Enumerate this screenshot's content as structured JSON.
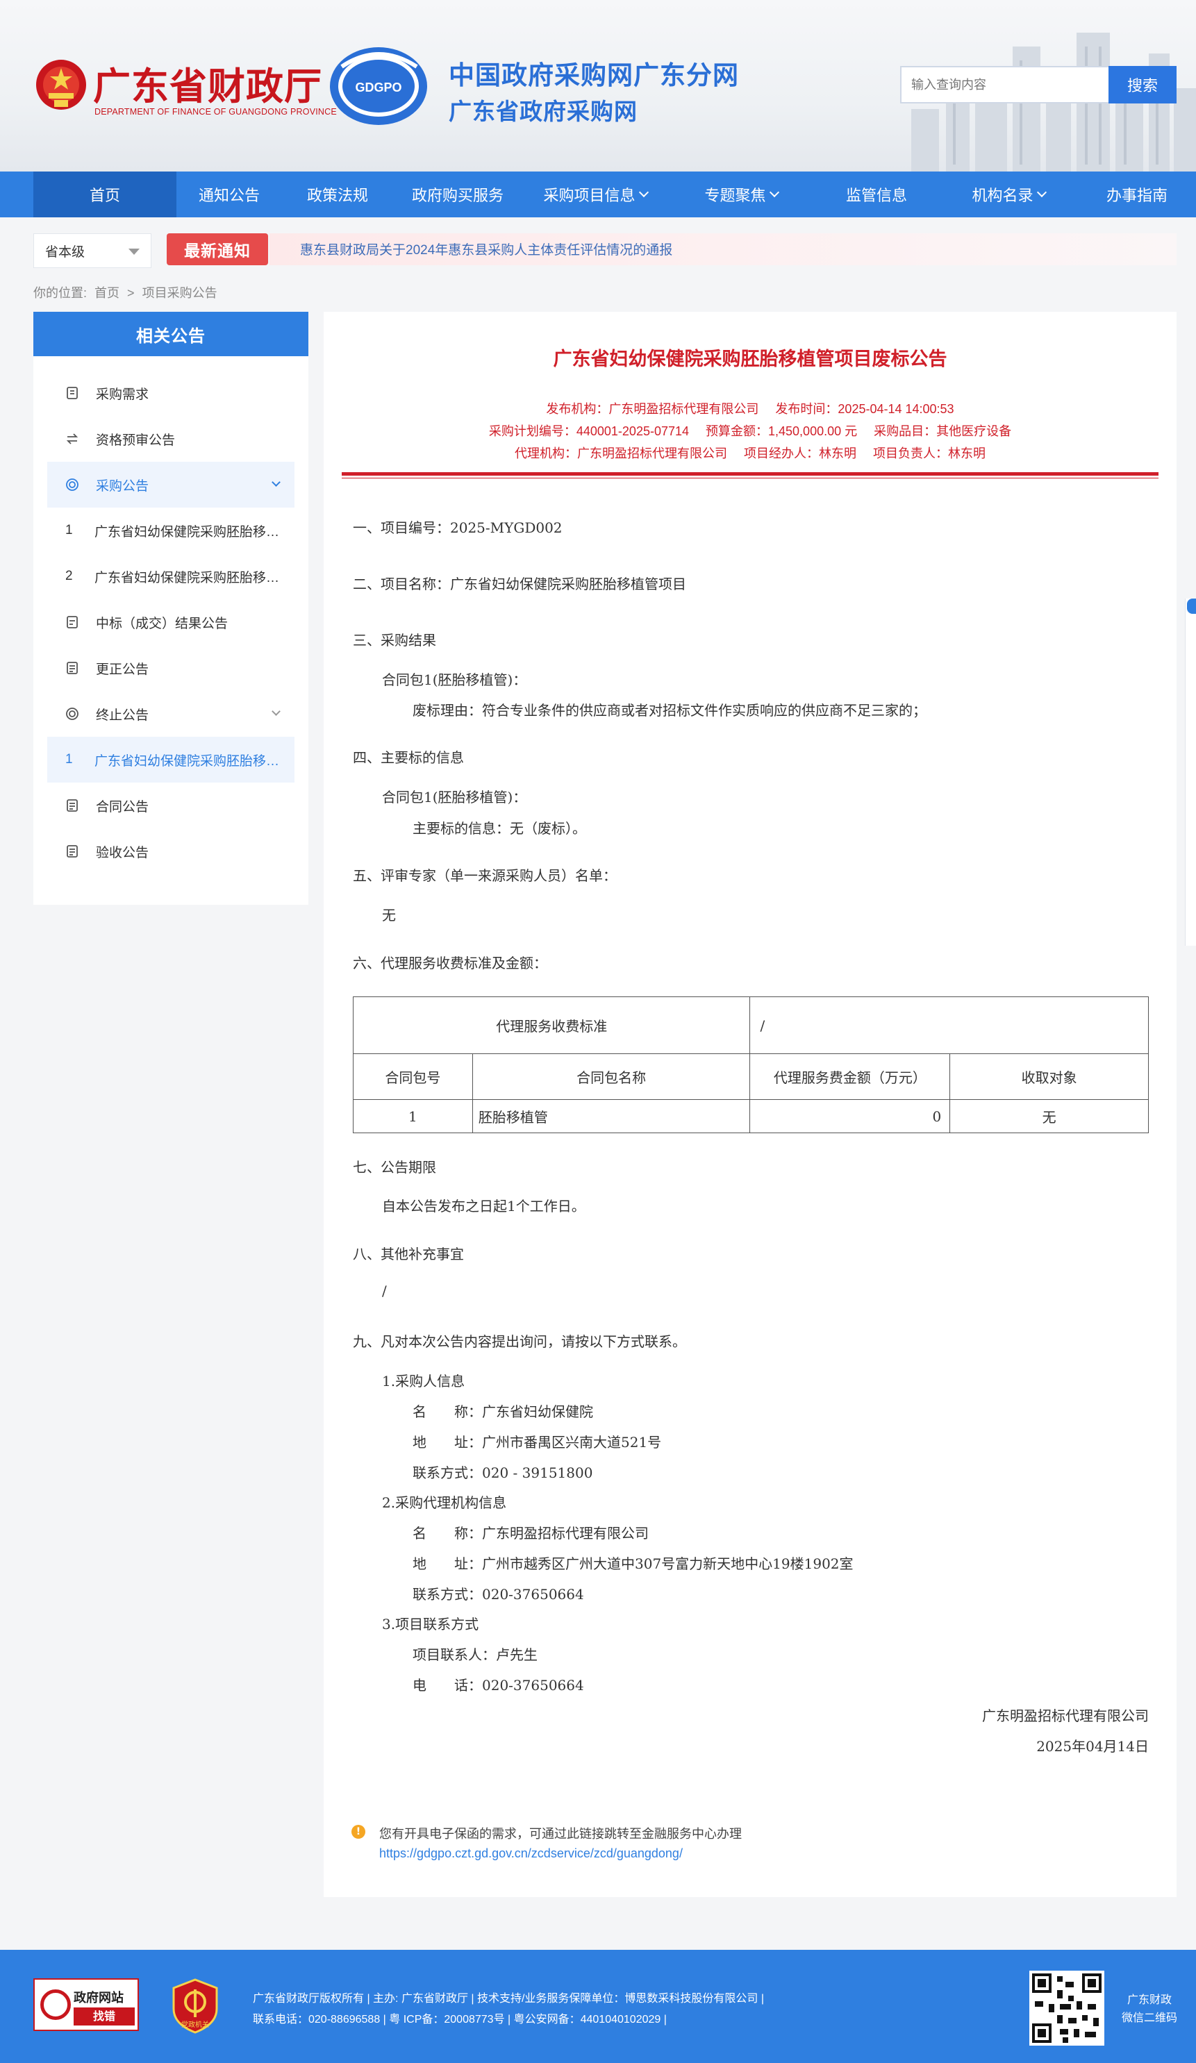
{
  "header": {
    "dept_title": "广东省财政厅",
    "dept_subtitle": "DEPARTMENT OF FINANCE OF GUANGDONG PROVINCE",
    "logo_text": "GDGPO",
    "site_title": "中国政府采购网广东分网",
    "site_subtitle": "广东省政府采购网",
    "search": {
      "placeholder": "输入查询内容",
      "button": "搜索"
    }
  },
  "nav": [
    {
      "label": "首页",
      "active": true,
      "has_menu": false
    },
    {
      "label": "通知公告",
      "has_menu": false
    },
    {
      "label": "政策法规",
      "has_menu": false
    },
    {
      "label": "政府购买服务",
      "has_menu": false
    },
    {
      "label": "采购项目信息",
      "has_menu": true
    },
    {
      "label": "专题聚焦",
      "has_menu": true
    },
    {
      "label": "监管信息",
      "has_menu": false
    },
    {
      "label": "机构名录",
      "has_menu": true
    },
    {
      "label": "办事指南",
      "has_menu": false
    }
  ],
  "notice": {
    "level": "省本级",
    "badge": "最新通知",
    "text": "惠东县财政局关于2024年惠东县采购人主体责任评估情况的通报"
  },
  "breadcrumb": {
    "prefix": "你的位置:",
    "home": "首页",
    "sep": ">",
    "current": "项目采购公告"
  },
  "sidebar": {
    "title": "相关公告",
    "items": [
      {
        "type": "cat",
        "icon": "list-icon",
        "label": "采购需求"
      },
      {
        "type": "cat",
        "icon": "swap-icon",
        "label": "资格预审公告"
      },
      {
        "type": "cat",
        "icon": "target-icon",
        "label": "采购公告",
        "selected": true,
        "expand": true
      },
      {
        "type": "sub",
        "num": "1",
        "label": "广东省妇幼保健院采购胚胎移植管项目"
      },
      {
        "type": "sub",
        "num": "2",
        "label": "广东省妇幼保健院采购胚胎移植管项目"
      },
      {
        "type": "cat",
        "icon": "award-icon",
        "label": "中标（成交）结果公告"
      },
      {
        "type": "cat",
        "icon": "doc-icon",
        "label": "更正公告"
      },
      {
        "type": "cat",
        "icon": "target-icon",
        "label": "终止公告",
        "expand": true
      },
      {
        "type": "sub",
        "num": "1",
        "label": "广东省妇幼保健院采购胚胎移植管项目",
        "selected": true
      },
      {
        "type": "cat",
        "icon": "doc-icon",
        "label": "合同公告"
      },
      {
        "type": "cat",
        "icon": "doc-icon",
        "label": "验收公告"
      }
    ]
  },
  "article": {
    "title": "广东省妇幼保健院采购胚胎移植管项目废标公告",
    "meta1": [
      "发布机构：广东明盈招标代理有限公司",
      "发布时间：2025-04-14 14:00:53"
    ],
    "meta2": [
      "采购计划编号：440001-2025-07714",
      "预算金额：1,450,000.00 元",
      "采购品目：其他医疗设备"
    ],
    "meta3": [
      "代理机构：广东明盈招标代理有限公司",
      "项目经办人：林东明",
      "项目负责人：林东明"
    ],
    "s1": "一、项目编号：2025-MYGD002",
    "s2": "二、项目名称：广东省妇幼保健院采购胚胎移植管项目",
    "s3": "三、采购结果",
    "s3_pkg": "合同包1(胚胎移植管)：",
    "s3_reason": "废标理由：符合专业条件的供应商或者对招标文件作实质响应的供应商不足三家的；",
    "s4": "四、主要标的信息",
    "s4_pkg": "合同包1(胚胎移植管)：",
    "s4_info": "主要标的信息：无（废标）。",
    "s5": "五、评审专家（单一来源采购人员）名单：",
    "s5_val": "无",
    "s6": "六、代理服务收费标准及金额：",
    "fee_table": {
      "std_label": "代理服务收费标准",
      "std_value": "/",
      "headers": [
        "合同包号",
        "合同包名称",
        "代理服务费金额（万元）",
        "收取对象"
      ],
      "rows": [
        [
          "1",
          "胚胎移植管",
          "0",
          "无"
        ]
      ]
    },
    "s7": "七、公告期限",
    "s7_val": "自本公告发布之日起1个工作日。",
    "s8": "八、其他补充事宜",
    "s8_val": "/",
    "s9": "九、凡对本次公告内容提出询问，请按以下方式联系。",
    "c1_title": "1.采购人信息",
    "c1_name": "名　　称：广东省妇幼保健院",
    "c1_addr": "地　　址：广州市番禺区兴南大道521号",
    "c1_tel": "联系方式：020 - 39151800",
    "c2_title": "2.采购代理机构信息",
    "c2_name": "名　　称：广东明盈招标代理有限公司",
    "c2_addr": "地　　址：广州市越秀区广州大道中307号富力新天地中心19楼1902室",
    "c2_tel": "联系方式：020-37650664",
    "c3_title": "3.项目联系方式",
    "c3_person": "项目联系人：卢先生",
    "c3_tel": "电　　话：020-37650664",
    "sign_org": "广东明盈招标代理有限公司",
    "sign_date": "2025年04月14日",
    "tip_text": "您有开具电子保函的需求，可通过此链接跳转至金融服务中心办理",
    "tip_link": "https://gdgpo.czt.gd.gov.cn/zcdservice/zcd/guangdong/"
  },
  "footer": {
    "gov_badge_l1": "政府网站",
    "gov_badge_l2": "找错",
    "party_badge": "党政机关",
    "line1": "广东省财政厅版权所有 | 主办: 广东省财政厅 | 技术支持/业务服务保障单位：博思数采科技股份有限公司 |",
    "line2": "联系电话：020-88696588 | 粤 ICP备：20008773号 | 粤公安网备：4401040102029 |",
    "qr_label_1": "广东财政",
    "qr_label_2": "微信二维码"
  },
  "colors": {
    "brand_blue": "#2f7fe0",
    "title_red": "#d0202a",
    "dept_red": "#c8161d"
  }
}
